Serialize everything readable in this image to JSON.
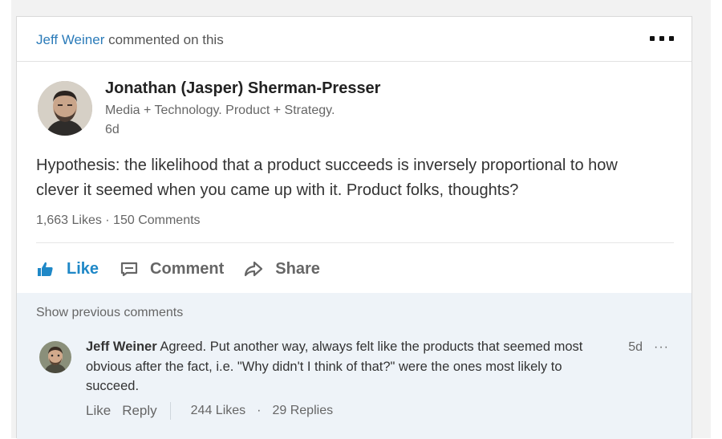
{
  "header": {
    "actor": "Jeff Weiner",
    "action": " commented on this",
    "more_icon": "more-horizontal-icon"
  },
  "post": {
    "author": {
      "name": "Jonathan (Jasper) Sherman-Presser",
      "headline": "Media + Technology. Product + Strategy.",
      "time": "6d"
    },
    "text_line1": "Hypothesis: the likelihood that a product succeeds is inversely proportional to how",
    "text_line2": "clever it seemed when you came up with it. Product folks, thoughts?",
    "stats": "1,663 Likes · 150 Comments"
  },
  "actions": {
    "like": "Like",
    "comment": "Comment",
    "share": "Share",
    "like_icon": "thumbs-up-icon",
    "comment_icon": "comment-icon",
    "share_icon": "share-arrow-icon",
    "like_color": "#1f88c7"
  },
  "comments": {
    "show_previous": "Show previous comments",
    "items": [
      {
        "author": "Jeff Weiner",
        "text": "Agreed. Put another way, always felt like the products that seemed most obvious after the fact, i.e. \"Why didn't I think of that?\" were the ones most likely to succeed.",
        "time": "5d",
        "like": "Like",
        "reply": "Reply",
        "likes": "244 Likes",
        "replies": "29 Replies"
      }
    ]
  },
  "colors": {
    "link_blue": "#2b7bb9",
    "comments_bg": "#eef3f8",
    "text_gray": "#666666"
  }
}
